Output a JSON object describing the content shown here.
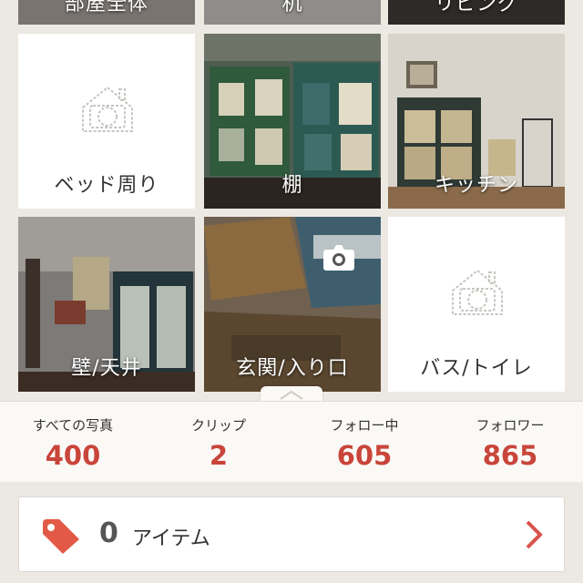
{
  "rooms": {
    "top_row": [
      "部屋全体",
      "机",
      "リビング"
    ],
    "tiles": [
      {
        "label": "ベッド周り",
        "has_photo": false
      },
      {
        "label": "棚",
        "has_photo": true
      },
      {
        "label": "キッチン",
        "has_photo": true
      },
      {
        "label": "壁/天井",
        "has_photo": true
      },
      {
        "label": "玄関/入り口",
        "has_photo": true
      },
      {
        "label": "バス/トイレ",
        "has_photo": false
      }
    ]
  },
  "stats": [
    {
      "name": "すべての写真",
      "value": "400"
    },
    {
      "name": "クリップ",
      "value": "2"
    },
    {
      "name": "フォロー中",
      "value": "605"
    },
    {
      "name": "フォロワー",
      "value": "865"
    }
  ],
  "items": {
    "count": "0",
    "label": "アイテム"
  },
  "colors": {
    "accent": "#c9453a",
    "tag": "#e25a47",
    "chevron": "#d9534a"
  },
  "icons": {
    "placeholder": "camera-house-icon",
    "camera": "camera-icon",
    "tag": "tag-icon",
    "chevron": "chevron-right-icon"
  }
}
